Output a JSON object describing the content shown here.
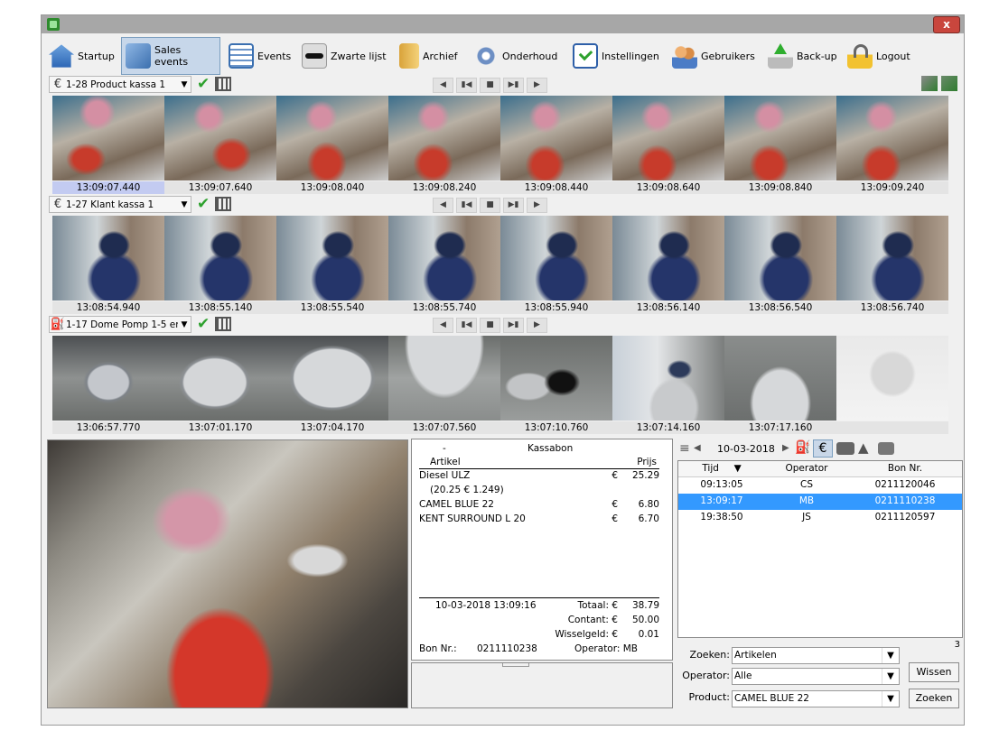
{
  "window": {
    "close_label": "x",
    "corner_count": "3"
  },
  "toolbar": [
    {
      "label": "Startup"
    },
    {
      "label": "Sales events"
    },
    {
      "label": "Events"
    },
    {
      "label": "Zwarte lijst"
    },
    {
      "label": "Archief"
    },
    {
      "label": "Onderhoud"
    },
    {
      "label": "Instellingen"
    },
    {
      "label": "Gebruikers"
    },
    {
      "label": "Back-up"
    },
    {
      "label": "Logout"
    }
  ],
  "cameras": [
    {
      "label": "1-28 Product kassa 1",
      "icon": "currency-euro-icon",
      "currency": "€",
      "timestamps": [
        "13:09:07.440",
        "13:09:07.640",
        "13:09:08.040",
        "13:09:08.240",
        "13:09:08.440",
        "13:09:08.640",
        "13:09:08.840",
        "13:09:09.240"
      ]
    },
    {
      "label": "1-27 Klant kassa 1",
      "icon": "currency-euro-icon",
      "currency": "€",
      "timestamps": [
        "13:08:54.940",
        "13:08:55.140",
        "13:08:55.540",
        "13:08:55.740",
        "13:08:55.940",
        "13:08:56.140",
        "13:08:56.540",
        "13:08:56.740"
      ]
    },
    {
      "label": "1-17 Dome Pomp 1-5 en",
      "icon": "fuel-pump-icon",
      "currency": "",
      "timestamps": [
        "13:06:57.770",
        "13:07:01.170",
        "13:07:04.170",
        "13:07:07.560",
        "13:07:10.760",
        "13:07:14.160",
        "13:07:17.160",
        ""
      ]
    }
  ],
  "receipt": {
    "dash": "-",
    "title": "Kassabon",
    "col_article": "Artikel",
    "col_price": "Prijs",
    "currency": "€",
    "items": [
      {
        "name": "Diesel ULZ",
        "price": "25.29"
      },
      {
        "name": "(20.25 € 1.249)",
        "price": ""
      },
      {
        "name": "CAMEL BLUE 22",
        "price": "6.80"
      },
      {
        "name": "KENT SURROUND L 20",
        "price": "6.70"
      }
    ],
    "datetime": "10-03-2018 13:09:16",
    "total_label": "Totaal: €",
    "total": "38.79",
    "cash_label": "Contant: €",
    "cash": "50.00",
    "change_label": "Wisselgeld: €",
    "change": "0.01",
    "bon_label": "Bon Nr.:",
    "bon_nr": "0211110238",
    "operator_label": "Operator: MB"
  },
  "transactions": {
    "date": "10-03-2018",
    "headers": [
      "Tijd",
      "Operator",
      "Bon Nr."
    ],
    "rows": [
      {
        "time": "09:13:05",
        "operator": "CS",
        "bon": "0211120046"
      },
      {
        "time": "13:09:17",
        "operator": "MB",
        "bon": "0211110238"
      },
      {
        "time": "19:38:50",
        "operator": "JS",
        "bon": "0211120597"
      }
    ],
    "selected_index": 1
  },
  "filters": {
    "search_label": "Zoeken:",
    "search_value": "Artikelen",
    "operator_label": "Operator:",
    "operator_value": "Alle",
    "product_label": "Product:",
    "product_value": "CAMEL BLUE 22",
    "clear_button": "Wissen",
    "search_button": "Zoeken"
  }
}
